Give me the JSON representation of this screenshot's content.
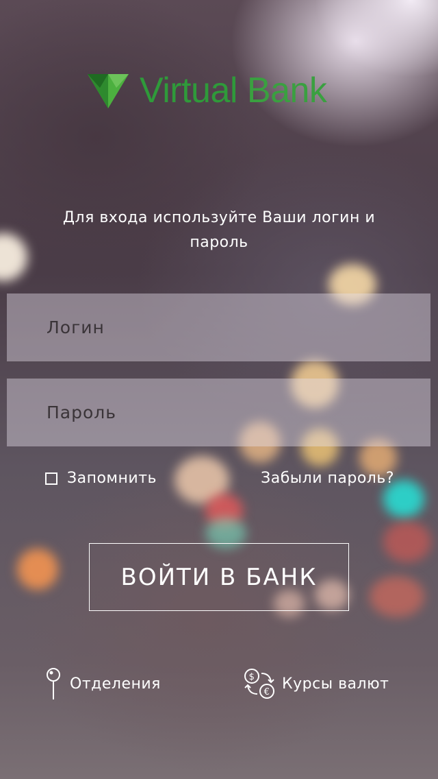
{
  "app": {
    "logo_virtual": "Virtual",
    "logo_bank": " Bank",
    "logo_icon": "triangle-logo-icon",
    "brand_color": "#3aa040"
  },
  "login_form": {
    "intro_text": "Для входа используйте Ваши логин и пароль",
    "login_placeholder": "Логин",
    "login_value": "",
    "password_placeholder": "Пароль",
    "password_value": "",
    "remember_label": "Запомнить",
    "remember_checked": false,
    "forgot_label": "Забыли пароль?",
    "submit_label": "ВОЙТИ В БАНК"
  },
  "footer": {
    "branches_label": "Отделения",
    "branches_icon": "map-pin-icon",
    "rates_label": "Курсы валют",
    "rates_icon": "currency-exchange-icon"
  }
}
